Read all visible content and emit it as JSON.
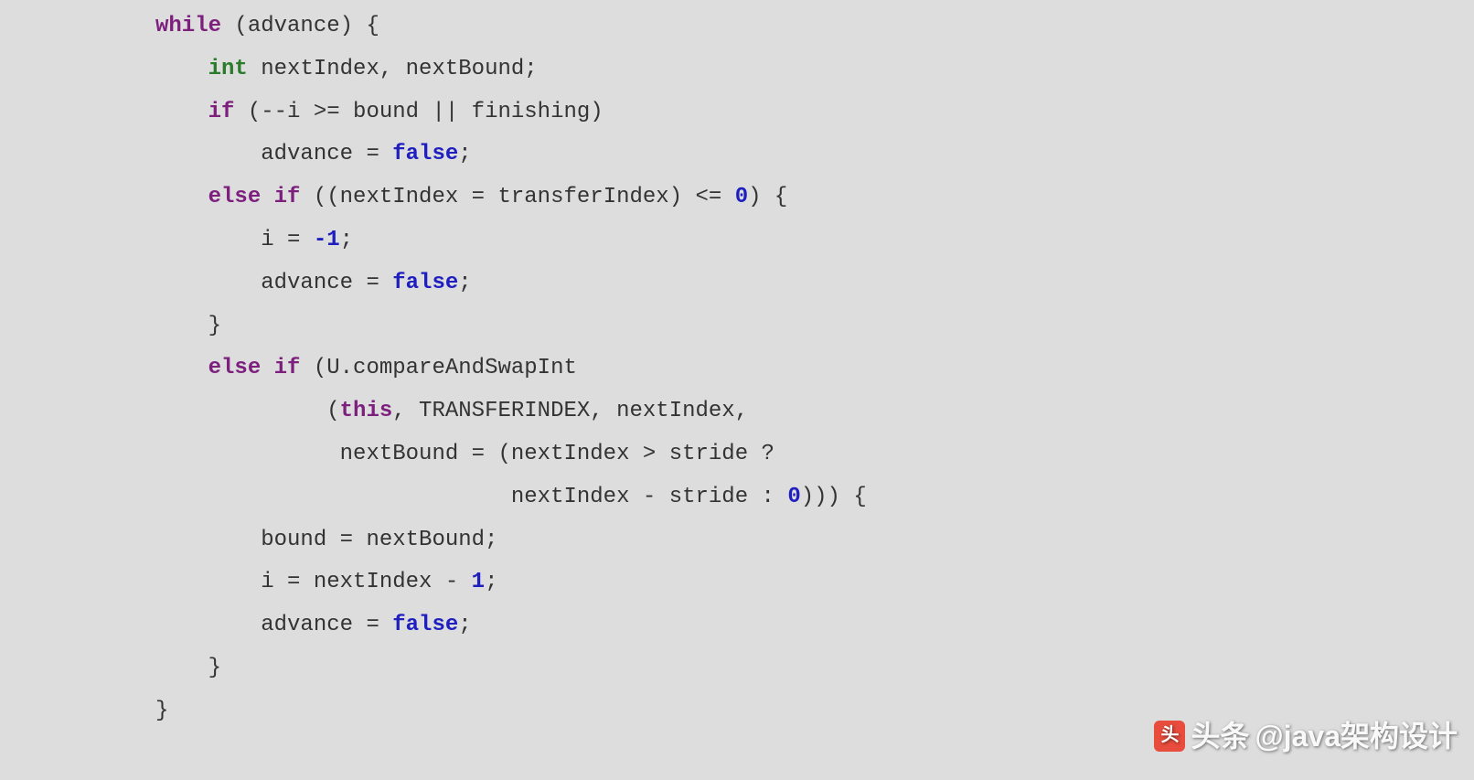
{
  "code": {
    "tokens": [
      {
        "cls": "kw",
        "t": "while"
      },
      {
        "cls": "pl",
        "t": " (advance) {"
      },
      {
        "cls": "nl"
      },
      {
        "cls": "pl",
        "t": "    "
      },
      {
        "cls": "ty",
        "t": "int"
      },
      {
        "cls": "pl",
        "t": " nextIndex, nextBound;"
      },
      {
        "cls": "nl"
      },
      {
        "cls": "pl",
        "t": "    "
      },
      {
        "cls": "kw",
        "t": "if"
      },
      {
        "cls": "pl",
        "t": " (--i >= bound || finishing)"
      },
      {
        "cls": "nl"
      },
      {
        "cls": "pl",
        "t": "        advance = "
      },
      {
        "cls": "lit",
        "t": "false"
      },
      {
        "cls": "pl",
        "t": ";"
      },
      {
        "cls": "nl"
      },
      {
        "cls": "pl",
        "t": "    "
      },
      {
        "cls": "kw",
        "t": "else if"
      },
      {
        "cls": "pl",
        "t": " ((nextIndex = transferIndex) <= "
      },
      {
        "cls": "lit",
        "t": "0"
      },
      {
        "cls": "pl",
        "t": ") {"
      },
      {
        "cls": "nl"
      },
      {
        "cls": "pl",
        "t": "        i = "
      },
      {
        "cls": "lit",
        "t": "-1"
      },
      {
        "cls": "pl",
        "t": ";"
      },
      {
        "cls": "nl"
      },
      {
        "cls": "pl",
        "t": "        advance = "
      },
      {
        "cls": "lit",
        "t": "false"
      },
      {
        "cls": "pl",
        "t": ";"
      },
      {
        "cls": "nl"
      },
      {
        "cls": "pl",
        "t": "    }"
      },
      {
        "cls": "nl"
      },
      {
        "cls": "pl",
        "t": "    "
      },
      {
        "cls": "kw",
        "t": "else if"
      },
      {
        "cls": "pl",
        "t": " (U.compareAndSwapInt"
      },
      {
        "cls": "nl"
      },
      {
        "cls": "pl",
        "t": "             ("
      },
      {
        "cls": "kw",
        "t": "this"
      },
      {
        "cls": "pl",
        "t": ", TRANSFERINDEX, nextIndex,"
      },
      {
        "cls": "nl"
      },
      {
        "cls": "pl",
        "t": "              nextBound = (nextIndex > stride ?"
      },
      {
        "cls": "nl"
      },
      {
        "cls": "pl",
        "t": "                           nextIndex - stride : "
      },
      {
        "cls": "lit",
        "t": "0"
      },
      {
        "cls": "pl",
        "t": "))) {"
      },
      {
        "cls": "nl"
      },
      {
        "cls": "pl",
        "t": "        bound = nextBound;"
      },
      {
        "cls": "nl"
      },
      {
        "cls": "pl",
        "t": "        i = nextIndex - "
      },
      {
        "cls": "lit",
        "t": "1"
      },
      {
        "cls": "pl",
        "t": ";"
      },
      {
        "cls": "nl"
      },
      {
        "cls": "pl",
        "t": "        advance = "
      },
      {
        "cls": "lit",
        "t": "false"
      },
      {
        "cls": "pl",
        "t": ";"
      },
      {
        "cls": "nl"
      },
      {
        "cls": "pl",
        "t": "    }"
      },
      {
        "cls": "nl"
      },
      {
        "cls": "pl",
        "t": "}"
      }
    ]
  },
  "watermark": {
    "prefix": "头条",
    "handle": "@java架构设计"
  }
}
